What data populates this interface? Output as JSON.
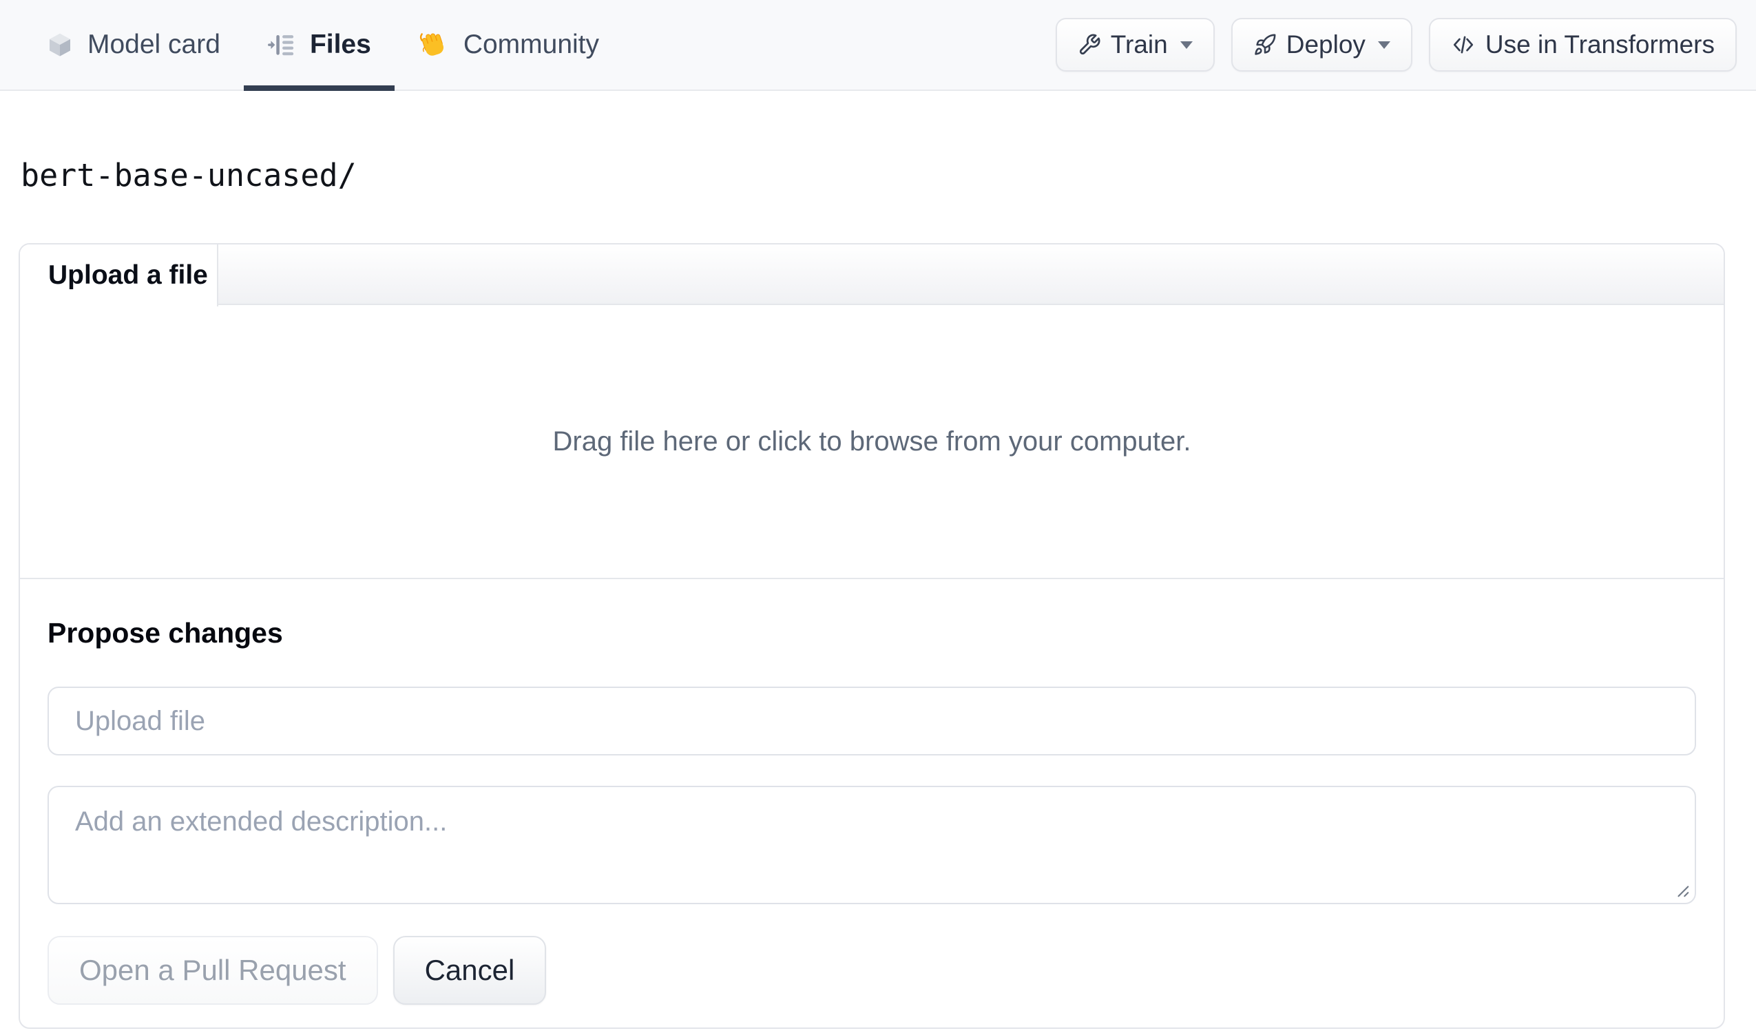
{
  "header": {
    "tabs": [
      {
        "label": "Model card",
        "icon": "cube-icon",
        "active": false
      },
      {
        "label": "Files",
        "icon": "files-list-icon",
        "active": true
      },
      {
        "label": "Community",
        "icon": "wave-hand-icon",
        "active": false
      }
    ],
    "actions": [
      {
        "label": "Train",
        "icon": "wrench-icon",
        "has_dropdown": true
      },
      {
        "label": "Deploy",
        "icon": "rocket-icon",
        "has_dropdown": true
      },
      {
        "label": "Use in Transformers",
        "icon": "code-icon",
        "has_dropdown": false
      }
    ]
  },
  "path_bar": {
    "current_path": "bert-base-uncased/"
  },
  "upload_card": {
    "active_tab_label": "Upload a file",
    "dropzone_hint": "Drag file here or click to browse from your computer.",
    "propose_changes": {
      "heading": "Propose changes",
      "file_name_placeholder": "Upload file",
      "file_name_value": "",
      "description_placeholder": "Add an extended description...",
      "description_value": "",
      "open_pr_label": "Open a Pull Request",
      "cancel_label": "Cancel"
    }
  },
  "colors": {
    "nav_background": "#f8f9fb",
    "active_tab_underline": "#333e51",
    "panel_border": "#e3e5ea",
    "hint_text": "#5d6878",
    "placeholder_text": "#9aa3b3",
    "wave_hand": "#fbbf24",
    "disabled_button_text": "#99a1ad"
  }
}
